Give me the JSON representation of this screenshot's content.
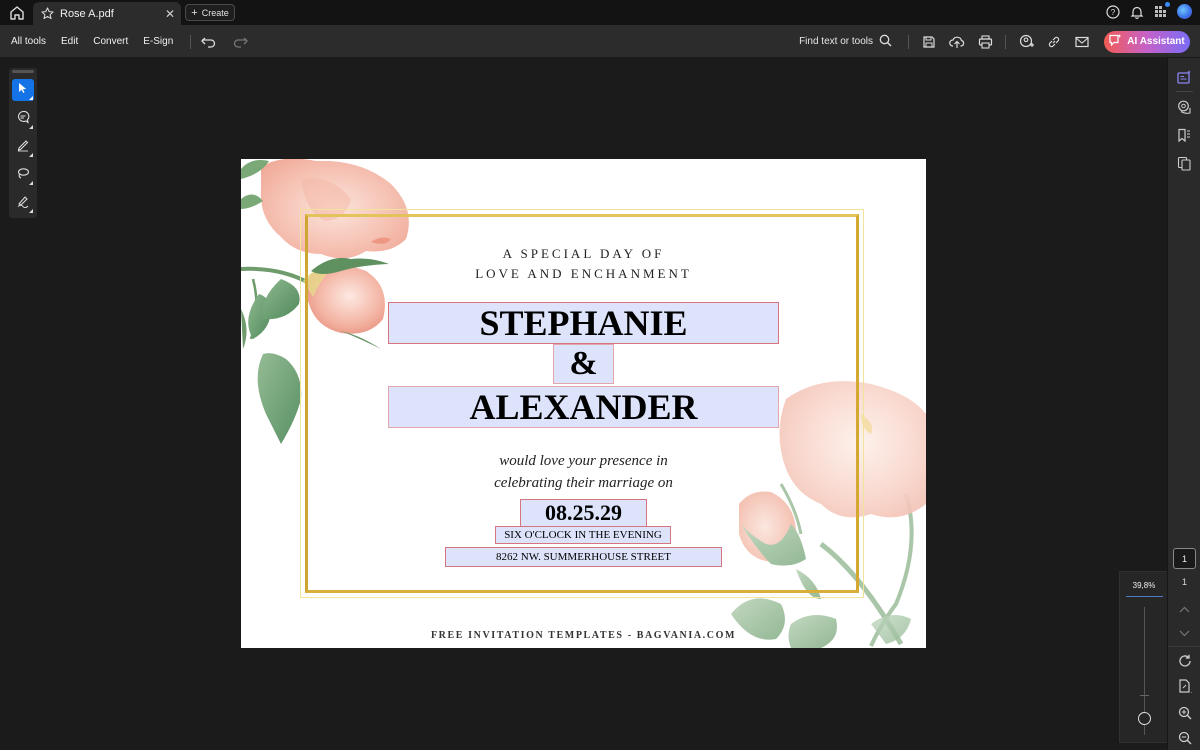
{
  "tabbar": {
    "tab_title": "Rose A.pdf",
    "create_label": "Create",
    "icons": [
      "home-icon",
      "star-icon",
      "close-icon",
      "plus-icon",
      "help-icon",
      "bell-icon",
      "apps-icon",
      "avatar"
    ]
  },
  "toolbar": {
    "menu": [
      "All tools",
      "Edit",
      "Convert",
      "E-Sign"
    ],
    "find_label": "Find text or tools",
    "ai_label": "AI Assistant",
    "icons": [
      "undo-icon",
      "redo-icon",
      "search-icon",
      "save-icon",
      "upload-icon",
      "print-icon",
      "share-icon",
      "link-icon",
      "mail-icon"
    ],
    "ai_gradient": [
      "#f25c54",
      "#c561c9",
      "#7a6cf5"
    ]
  },
  "left_tools": [
    "select-tool",
    "comment-tool",
    "draw-tool",
    "lasso-tool",
    "sign-tool"
  ],
  "right_rail": {
    "icons": [
      "ai-panel-icon",
      "comments-icon",
      "bookmarks-icon",
      "pages-icon"
    ],
    "current_page": "1",
    "total_pages": "1",
    "bottom_icons": [
      "chevron-up-icon",
      "chevron-down-icon",
      "rotate-icon",
      "page-settings-icon",
      "zoom-in-icon",
      "zoom-out-icon"
    ]
  },
  "zoom": {
    "value": "39,8%",
    "level_percent": 39.8
  },
  "document": {
    "subtitle_line1": "A SPECIAL DAY OF",
    "subtitle_line2": "LOVE AND ENCHANMENT",
    "name1": "STEPHANIE",
    "ampersand": "&",
    "name2": "ALEXANDER",
    "line1": "would love your presence in",
    "line2": "celebrating their marriage on",
    "date": "08.25.29",
    "time": "SIX O'CLOCK IN THE EVENING",
    "address": "8262 NW. SUMMERHOUSE STREET",
    "footer": "FREE INVITATION TEMPLATES - BAGVANIA.COM",
    "colors": {
      "field_fill": "#dde3fb",
      "field_border": "#d6757d",
      "gold": "#d9ae3a"
    }
  }
}
